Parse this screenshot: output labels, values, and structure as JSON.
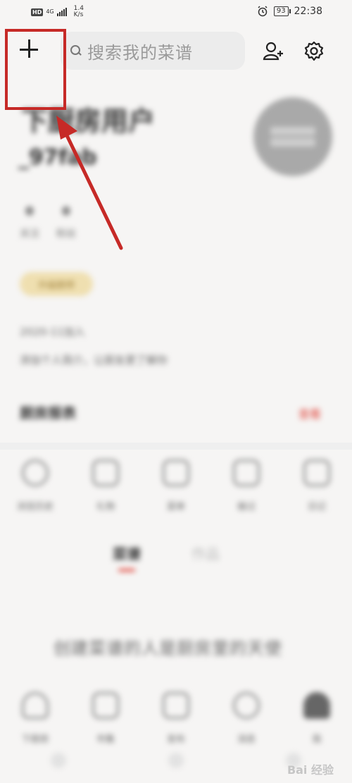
{
  "status_bar": {
    "hd": "HD",
    "network": "4G",
    "speed_value": "1.4",
    "speed_unit": "K/s",
    "battery": "93",
    "time": "22:38"
  },
  "top_bar": {
    "search_placeholder": "搜索我的菜谱"
  },
  "profile": {
    "username": "下厨房用户",
    "user_id": "_97fab",
    "stats": [
      {
        "value": "0",
        "label": "关注"
      },
      {
        "value": "0",
        "label": "粉丝"
      }
    ],
    "badge": "升级厨师",
    "info_line_1": "2020-11加入",
    "info_line_2": "添加个人简介，让厨友更了解你"
  },
  "section": {
    "title": "厨房报表",
    "link": "查看"
  },
  "shortcut_icons": [
    {
      "icon": "history-icon",
      "label": "浏览历史"
    },
    {
      "icon": "gift-icon",
      "label": "礼物"
    },
    {
      "icon": "collection-icon",
      "label": "菜单"
    },
    {
      "icon": "cook-icon",
      "label": "做过"
    },
    {
      "icon": "calendar-icon",
      "label": "日记"
    }
  ],
  "tabs": [
    {
      "label": "菜谱",
      "active": true
    },
    {
      "label": "作品",
      "active": false
    }
  ],
  "empty_state_text": "创建菜谱的人是厨房里的天使",
  "bottom_icons": [
    {
      "icon": "market-icon",
      "label": "下厨房"
    },
    {
      "icon": "store-icon",
      "label": "市集"
    },
    {
      "icon": "post-icon",
      "label": "发布"
    },
    {
      "icon": "message-icon",
      "label": "消息"
    },
    {
      "icon": "me-icon",
      "label": "我"
    }
  ],
  "watermark": "Bai 经验"
}
